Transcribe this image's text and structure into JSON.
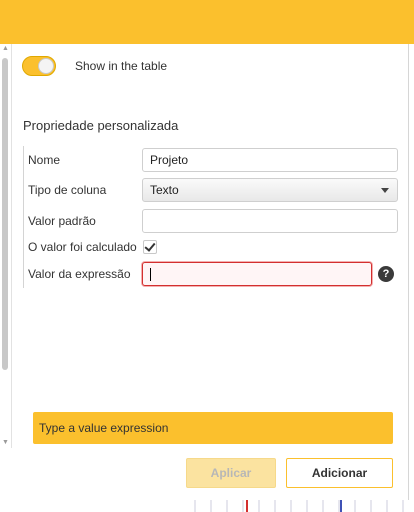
{
  "colors": {
    "accent": "#fbc02d",
    "error": "#d32f2f"
  },
  "toggle": {
    "label": "Show in the table",
    "on": true
  },
  "section": {
    "title": "Propriedade personalizada"
  },
  "form": {
    "name": {
      "label": "Nome",
      "value": "Projeto"
    },
    "column_type": {
      "label": "Tipo de coluna",
      "value": "Texto"
    },
    "default_value": {
      "label": "Valor padrão",
      "value": ""
    },
    "calculated": {
      "label": "O valor foi calculado",
      "checked": true
    },
    "expression": {
      "label": "Valor da expressão",
      "value": "",
      "help_icon": "question-icon"
    }
  },
  "message": {
    "text": "Type a value expression"
  },
  "buttons": {
    "apply": "Aplicar",
    "add": "Adicionar"
  }
}
